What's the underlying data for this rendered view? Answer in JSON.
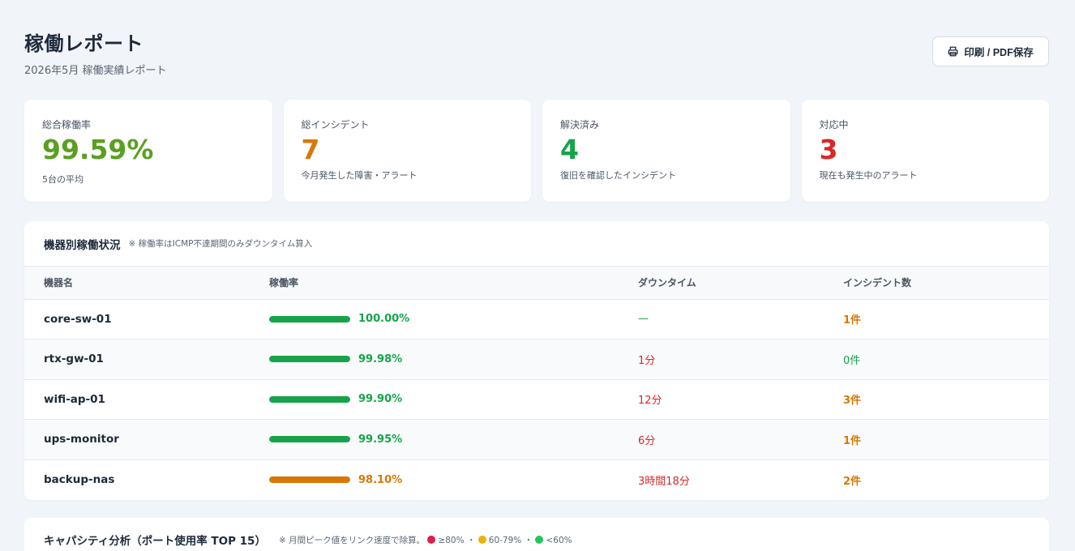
{
  "header": {
    "title": "稼働レポート",
    "subtitle": "2026年5月 稼働実績レポート",
    "print_label": "印刷 / PDF保存"
  },
  "cards": [
    {
      "label": "総合稼働率",
      "value": "99.59%",
      "note": "5台の平均",
      "color": "#5aa020"
    },
    {
      "label": "総インシデント",
      "value": "7",
      "note": "今月発生した障害・アラート",
      "color": "#d97706"
    },
    {
      "label": "解決済み",
      "value": "4",
      "note": "復旧を確認したインシデント",
      "color": "#16a34a"
    },
    {
      "label": "対応中",
      "value": "3",
      "note": "現在も発生中のアラート",
      "color": "#dc2626"
    }
  ],
  "devices": {
    "title": "機器別稼働状況",
    "note": "※ 稼働率はICMP不達期間のみダウンタイム算入",
    "columns": [
      "機器名",
      "稼働率",
      "ダウンタイム",
      "インシデント数"
    ],
    "rows": [
      {
        "name": "core-sw-01",
        "rate": "100.00%",
        "fill": 1.0,
        "bar_color": "#16a34a",
        "downtime": "—",
        "downtime_color": "#16a34a",
        "incidents": "1件",
        "inc_color": "#d97706",
        "inc_bold": true
      },
      {
        "name": "rtx-gw-01",
        "rate": "99.98%",
        "fill": 1.0,
        "bar_color": "#16a34a",
        "downtime": "1分",
        "downtime_color": "#dc2626",
        "incidents": "0件",
        "inc_color": "#16a34a",
        "inc_bold": false
      },
      {
        "name": "wifi-ap-01",
        "rate": "99.90%",
        "fill": 1.0,
        "bar_color": "#16a34a",
        "downtime": "12分",
        "downtime_color": "#dc2626",
        "incidents": "3件",
        "inc_color": "#d97706",
        "inc_bold": true
      },
      {
        "name": "ups-monitor",
        "rate": "99.95%",
        "fill": 1.0,
        "bar_color": "#16a34a",
        "downtime": "6分",
        "downtime_color": "#dc2626",
        "incidents": "1件",
        "inc_color": "#d97706",
        "inc_bold": true
      },
      {
        "name": "backup-nas",
        "rate": "98.10%",
        "fill": 1.0,
        "bar_color": "#d97706",
        "downtime": "3時間18分",
        "downtime_color": "#dc2626",
        "incidents": "2件",
        "inc_color": "#d97706",
        "inc_bold": true
      }
    ]
  },
  "capacity": {
    "title": "キャパシティ分析（ポート使用率 TOP 15）",
    "note_prefix": "※ 月間ピーク値をリンク速度で除算。",
    "legend": [
      {
        "label": "≥80%",
        "color": "#e11d48"
      },
      {
        "label": "60-79%",
        "color": "#eab308"
      },
      {
        "label": "<60%",
        "color": "#22c55e"
      }
    ],
    "separator": "・"
  }
}
